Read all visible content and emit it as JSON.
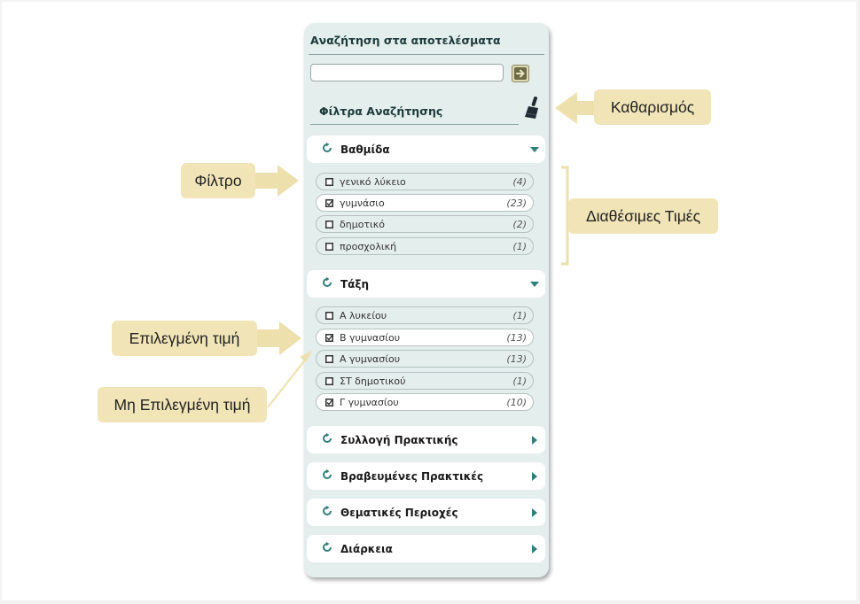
{
  "search": {
    "title": "Αναζήτηση στα αποτελέσματα",
    "input_value": "",
    "placeholder": ""
  },
  "filters": {
    "title": "Φίλτρα Αναζήτησης",
    "facets": [
      {
        "label": "Βαθμίδα",
        "expanded": true,
        "values": [
          {
            "label": "γενικό λύκειο",
            "count": "(4)",
            "selected": false
          },
          {
            "label": "γυμνάσιο",
            "count": "(23)",
            "selected": true
          },
          {
            "label": "δημοτικό",
            "count": "(2)",
            "selected": false
          },
          {
            "label": "προσχολική",
            "count": "(1)",
            "selected": false
          }
        ]
      },
      {
        "label": "Τάξη",
        "expanded": true,
        "values": [
          {
            "label": "Α λυκείου",
            "count": "(1)",
            "selected": false
          },
          {
            "label": "Β γυμνασίου",
            "count": "(13)",
            "selected": true
          },
          {
            "label": "Α γυμνασίου",
            "count": "(13)",
            "selected": false
          },
          {
            "label": "ΣΤ δημοτικού",
            "count": "(1)",
            "selected": false
          },
          {
            "label": "Γ γυμνασίου",
            "count": "(10)",
            "selected": true
          }
        ]
      },
      {
        "label": "Συλλογή Πρακτικής",
        "expanded": false
      },
      {
        "label": "Βραβευμένες Πρακτικές",
        "expanded": false
      },
      {
        "label": "Θεματικές Περιοχές",
        "expanded": false
      },
      {
        "label": "Διάρκεια",
        "expanded": false
      }
    ]
  },
  "callouts": {
    "clear": "Καθαρισμός",
    "filter": "Φίλτρο",
    "available_values": "Διαθέσιμες Τιμές",
    "selected_value": "Επιλεγμένη τιμή",
    "unselected_value": "Μη Επιλεγμένη τιμή"
  },
  "colors": {
    "panel_bg": "#e4eeec",
    "accent_teal": "#2f7f7a",
    "callout_bg": "#f1e5b8",
    "callout_arrow": "#ede0ad"
  },
  "icons": {
    "go": "arrow-right-icon",
    "clear": "broom-icon",
    "reset": "refresh-icon",
    "expanded": "triangle-down-icon",
    "collapsed": "triangle-right-icon"
  }
}
